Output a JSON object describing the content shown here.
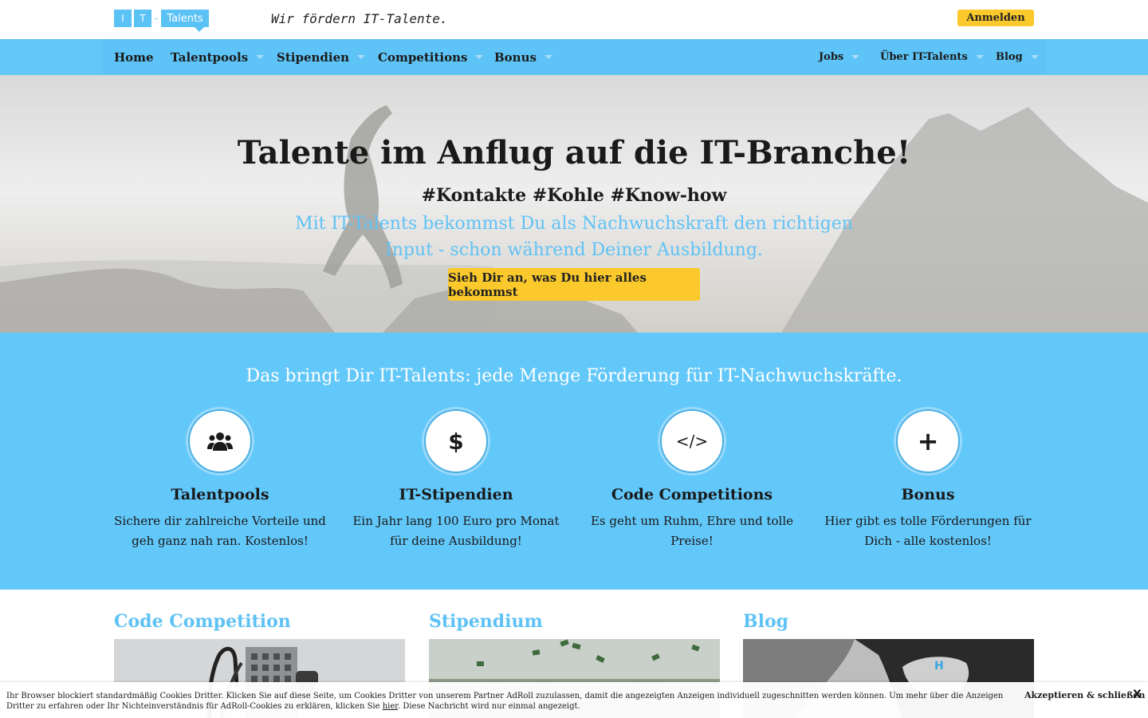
{
  "header": {
    "logo": {
      "letter1": "I",
      "letter2": "T",
      "dash": "-",
      "word": "Talents"
    },
    "tagline": "Wir fördern IT-Talente.",
    "login_label": "Anmelden"
  },
  "nav": {
    "left": [
      {
        "label": "Home",
        "dropdown": false
      },
      {
        "label": "Talentpools",
        "dropdown": true
      },
      {
        "label": "Stipendien",
        "dropdown": true
      },
      {
        "label": "Competitions",
        "dropdown": true
      },
      {
        "label": "Bonus",
        "dropdown": true
      }
    ],
    "right": [
      {
        "label": "Jobs",
        "dropdown": true
      },
      {
        "label": "Über IT-Talents",
        "dropdown": true
      },
      {
        "label": "Blog",
        "dropdown": true
      }
    ]
  },
  "hero": {
    "title": "Talente im Anflug auf die IT-Branche!",
    "tags": "#Kontakte #Kohle #Know-how",
    "subtitle": "Mit IT-Talents bekommst Du als Nachwuchskraft den richtigen Input - schon während Deiner Ausbildung.",
    "cta": "Sieh Dir an, was Du hier alles bekommst"
  },
  "features": {
    "heading": "Das bringt Dir IT-Talents: jede Menge Förderung für IT-Nachwuchskräfte.",
    "items": [
      {
        "icon": "users-icon",
        "glyph": "👥",
        "title": "Talentpools",
        "desc": "Sichere dir zahlreiche Vorteile und geh ganz nah ran. Kostenlos!"
      },
      {
        "icon": "dollar-icon",
        "glyph": "$",
        "title": "IT-Stipendien",
        "desc": "Ein Jahr lang 100 Euro pro Monat für deine Ausbildung!"
      },
      {
        "icon": "code-icon",
        "glyph": "</>",
        "title": "Code Competitions",
        "desc": "Es geht um Ruhm, Ehre und tolle Preise!"
      },
      {
        "icon": "plus-icon",
        "glyph": "+",
        "title": "Bonus",
        "desc": "Hier gibt es tolle Förderungen für Dich - alle kostenlos!"
      }
    ]
  },
  "columns": [
    {
      "title": "Code Competition"
    },
    {
      "title": "Stipendium"
    },
    {
      "title": "Blog"
    }
  ],
  "cookie": {
    "text_before": "Ihr Browser blockiert standardmäßig Cookies Dritter. Klicken Sie auf diese Seite, um Cookies Dritter von unserem Partner AdRoll zuzulassen, damit die angezeigten Anzeigen individuell zugeschnitten werden können. Um mehr über die Anzeigen Dritter zu erfahren oder Ihr Nichteinverständnis für AdRoll-Cookies zu erklären, klicken Sie ",
    "link": "hier",
    "text_after": ". Diese Nachricht wird nur einmal angezeigt.",
    "accept": "Akzeptieren & schließen",
    "close": "X"
  },
  "colors": {
    "brand_blue": "#62c7f9",
    "accent_yellow": "#fbc92b",
    "heading_blue": "#5fc2f5"
  }
}
